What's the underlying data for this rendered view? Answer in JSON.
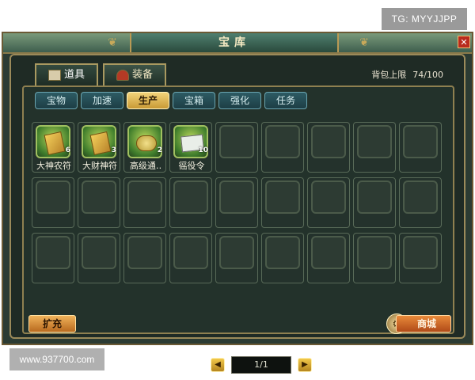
{
  "window": {
    "title": "宝库",
    "close_glyph": "✕"
  },
  "main_tabs": [
    {
      "label": "道具",
      "icon": "book-icon",
      "active": true
    },
    {
      "label": "装备",
      "icon": "hat-icon",
      "active": false
    }
  ],
  "bag": {
    "limit_label": "背包上限",
    "limit_value": "74/100"
  },
  "sub_tabs": [
    {
      "label": "宝物",
      "active": false
    },
    {
      "label": "加速",
      "active": false
    },
    {
      "label": "生产",
      "active": true
    },
    {
      "label": "宝箱",
      "active": false
    },
    {
      "label": "强化",
      "active": false
    },
    {
      "label": "任务",
      "active": false
    }
  ],
  "items": [
    {
      "label": "大神农符",
      "count": "6",
      "icon": "talisman-icon"
    },
    {
      "label": "大财神符",
      "count": "3",
      "icon": "talisman-icon"
    },
    {
      "label": "高级通‥",
      "count": "2",
      "icon": "ring-icon"
    },
    {
      "label": "徭役令",
      "count": "10",
      "icon": "scroll-icon"
    }
  ],
  "grid": {
    "rows": 3,
    "cols": 9
  },
  "pager": {
    "prev_glyph": "◀",
    "next_glyph": "▶",
    "page_text": "1/1"
  },
  "buttons": {
    "expand_label": "扩充",
    "shop_label": "商城"
  },
  "overlay": {
    "tg_tag": "TG: MYYJJPP",
    "watermark": "www.937700.com"
  },
  "colors": {
    "panel_bg": "#23322b",
    "frame_gold": "#9b8a5a",
    "active_subtab": "#f2d37a",
    "subtab_teal": "#2d5b64"
  }
}
